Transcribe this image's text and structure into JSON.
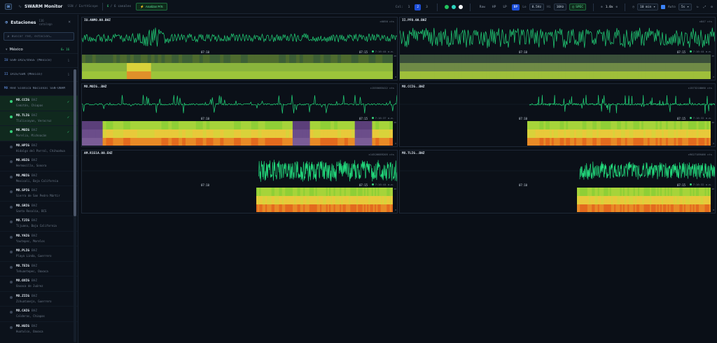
{
  "topbar": {
    "logo": "OK",
    "title": "SWARM Monitor",
    "subtitle": "SSN / EarthScope",
    "count_active": "6",
    "count_rest": "/ 6 canales",
    "analyze_label": "Analizar P/S",
    "col_label": "Col:",
    "cols": [
      "1",
      "2",
      "3"
    ],
    "filters": [
      "Raw",
      "HP",
      "LP",
      "BP"
    ],
    "lo_label": "Lo",
    "lo_value": "0.5Hz",
    "hi_label": "Hi",
    "hi_value": "10Hz",
    "spec_label": "SPEC",
    "gain_value": "1.0x",
    "window_value": "10 min",
    "auto_label": "Auto",
    "auto_value": "5s",
    "colors": {
      "accent": "#36d07a",
      "blue": "#1d4ed8",
      "wave": "#22d67a"
    }
  },
  "sidebar": {
    "title": "Estaciones",
    "catalog": "116 catalogo",
    "search_placeholder": "Buscar red, estación…",
    "region": {
      "name": "México",
      "count": "6▸ 16"
    },
    "networks": [
      {
        "code": "IU",
        "name": "GSN-IRIS/USGS (Mexico)",
        "count": "1"
      },
      {
        "code": "II",
        "name": "IRIS/GSN (Mexico)",
        "count": "1"
      },
      {
        "code": "MX",
        "name": "Red Sísmica Nacional SSN-UNAM",
        "count": ""
      }
    ],
    "stations": [
      {
        "code": "MX.CCIG",
        "ch": "BHZ",
        "loc": "Comitán, Chiapas",
        "selected": true
      },
      {
        "code": "MX.TLIG",
        "ch": "BHZ",
        "loc": "Tlalixcoyan, Veracruz",
        "selected": true
      },
      {
        "code": "MX.MOIG",
        "ch": "BHZ",
        "loc": "Morelia, Michoacán",
        "selected": true
      },
      {
        "code": "MX.HPIG",
        "ch": "BHZ",
        "loc": "Hidalgo del Parral, Chihuahua",
        "selected": false
      },
      {
        "code": "MX.HSIG",
        "ch": "BHZ",
        "loc": "Hermosillo, Sonora",
        "selected": false
      },
      {
        "code": "MX.MBIG",
        "ch": "BHZ",
        "loc": "Mexicali, Baja California",
        "selected": false
      },
      {
        "code": "MX.SPIG",
        "ch": "BHZ",
        "loc": "Sierra de San Pedro Mártir",
        "selected": false
      },
      {
        "code": "MX.SRIG",
        "ch": "BHZ",
        "loc": "Santa Rosalía, BCS",
        "selected": false
      },
      {
        "code": "MX.TJIG",
        "ch": "BHZ",
        "loc": "Tijuana, Baja California",
        "selected": false
      },
      {
        "code": "MX.YAIG",
        "ch": "BHZ",
        "loc": "Yautepec, Morelos",
        "selected": false
      },
      {
        "code": "MX.PLIG",
        "ch": "BHZ",
        "loc": "Playa Linda, Guerrero",
        "selected": false
      },
      {
        "code": "MX.TEIG",
        "ch": "BHZ",
        "loc": "Tehuantepec, Oaxaca",
        "selected": false
      },
      {
        "code": "MX.OXIG",
        "ch": "BHZ",
        "loc": "Oaxaca de Juárez",
        "selected": false
      },
      {
        "code": "MX.ZIIG",
        "ch": "BHZ",
        "loc": "Zihuatanejo, Guerrero",
        "selected": false
      },
      {
        "code": "MX.CAIG",
        "ch": "BHZ",
        "loc": "Calderas, Chiapas",
        "selected": false
      },
      {
        "code": "MX.HUIG",
        "ch": "BHZ",
        "loc": "Huatulco, Oaxaca",
        "selected": false
      }
    ]
  },
  "panels": [
    {
      "id": "IU.ANMO.00.BHZ",
      "cts": "±6050 cts",
      "time": "07:10",
      "time2": "07:15",
      "live": "7:16:44 a.m.",
      "hz_top": "20",
      "hz_bot": "0",
      "start": 0.0,
      "amp": 0.55,
      "style": "burst"
    },
    {
      "id": "II.PFO.00.BHZ",
      "cts": "±847 cts",
      "time": "07:10",
      "time2": "07:15",
      "live": "7:16:44 a.m.",
      "hz_top": "20",
      "hz_bot": "0",
      "start": 0.0,
      "amp": 0.8,
      "style": "dense"
    },
    {
      "id": "MX.MOIG..BHZ",
      "cts": "±1555685412 cts",
      "time": "07:10",
      "time2": "07:15",
      "live": "7:16:37 a.m.",
      "hz_top": "20",
      "hz_bot": "0",
      "start": 0.0,
      "amp": 0.7,
      "style": "spikes"
    },
    {
      "id": "MX.CCIG..BHZ",
      "cts": "±1573218060 cts",
      "time": "07:10",
      "time2": "07:15",
      "live": "7:16:32 a.m.",
      "hz_top": "20",
      "hz_bot": "0",
      "start": 0.41,
      "amp": 0.7,
      "style": "spikes"
    },
    {
      "id": "AM.R151A.00.EHZ",
      "cts": "±14526689205 cts",
      "time": "07:10",
      "time2": "07:15",
      "live": "7:16:44 a.m.",
      "hz_top": "20",
      "hz_bot": "0",
      "start": 0.56,
      "amp": 0.85,
      "style": "dense"
    },
    {
      "id": "MX.TLIG..BHZ",
      "cts": "±9627189466 cts",
      "time": "07:10",
      "time2": "07:15",
      "live": "7:16:32 a.m.",
      "hz_top": "20",
      "hz_bot": "0",
      "start": 0.57,
      "amp": 0.7,
      "style": "dense"
    }
  ]
}
